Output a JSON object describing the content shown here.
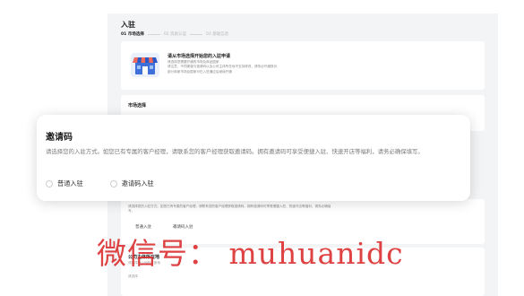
{
  "page": {
    "title": "入驻",
    "steps": [
      {
        "label": "01 市场选择",
        "active": true
      },
      {
        "label": "02 资质认证",
        "active": false
      },
      {
        "label": "03 基础信息",
        "active": false
      }
    ]
  },
  "intro": {
    "title": "请从市场选择开始您的入驻申请",
    "desc_lines": [
      "请选择您需要开通的市场及商品国家",
      "请注意，不同渠道与邀请码以及公司主体所在地不支持修改，请务必仔细核对",
      "部分商家市场及国家可在入驻通过后继续开通"
    ],
    "illustration_icon": "storefront-icon"
  },
  "market": {
    "label": "市场选择"
  },
  "modal": {
    "title": "邀请码",
    "desc": "请选择您的入驻方式。如您已有专属的客户经理，请联系您的客户经理获取邀请码。拥有邀请码可享受便捷入驻、快速开店等福利，请务必确保填写。",
    "options": [
      {
        "label": "普通入驻",
        "checked": false
      },
      {
        "label": "邀请码入驻",
        "checked": false
      }
    ]
  },
  "background_section": {
    "desc_lines": [
      "请选择您的入驻方式。如您已有专属的客户经理，请联系您的客户经理获取邀请码。拥有邀请码可享受便捷入驻、快速开店等福利，请务必确保",
      "写。"
    ],
    "options": [
      "普通入驻",
      "邀请码入驻"
    ]
  },
  "entity": {
    "label": "公司主体所在地",
    "sub": "请选择您公司的注册地",
    "mini": "请选择"
  },
  "watermark": {
    "text": "微信号： muhuanidc",
    "color": "#da2828"
  }
}
